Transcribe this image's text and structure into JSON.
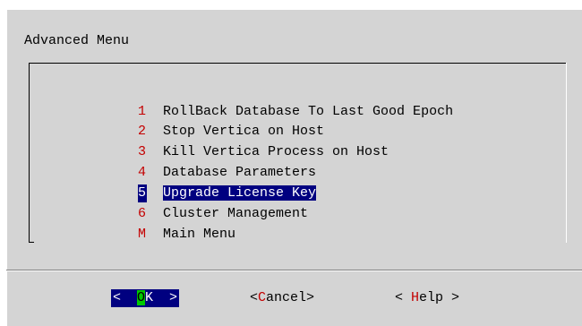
{
  "dialog": {
    "title": "Advanced Menu"
  },
  "menu": {
    "items": [
      {
        "key": "1",
        "label": "RollBack Database To Last Good Epoch",
        "selected": false
      },
      {
        "key": "2",
        "label": "Stop Vertica on Host",
        "selected": false
      },
      {
        "key": "3",
        "label": "Kill Vertica Process on Host",
        "selected": false
      },
      {
        "key": "4",
        "label": "Database Parameters",
        "selected": false
      },
      {
        "key": "5",
        "label": "Upgrade License Key",
        "selected": true
      },
      {
        "key": "6",
        "label": "Cluster Management",
        "selected": false
      },
      {
        "key": "M",
        "label": "Main Menu",
        "selected": false
      }
    ]
  },
  "buttons": {
    "ok": {
      "prefix": "<  ",
      "hotkey": "O",
      "rest": "K  >"
    },
    "cancel": {
      "prefix": "<",
      "hotkey": "C",
      "rest": "ancel>"
    },
    "help": {
      "prefix": "< ",
      "hotkey": "H",
      "rest": "elp >"
    }
  },
  "colors": {
    "dialog_bg": "#d4d4d4",
    "selection_bg": "#000080",
    "hotkey_red": "#c40000",
    "ok_hotkey_bg": "#00c800"
  }
}
